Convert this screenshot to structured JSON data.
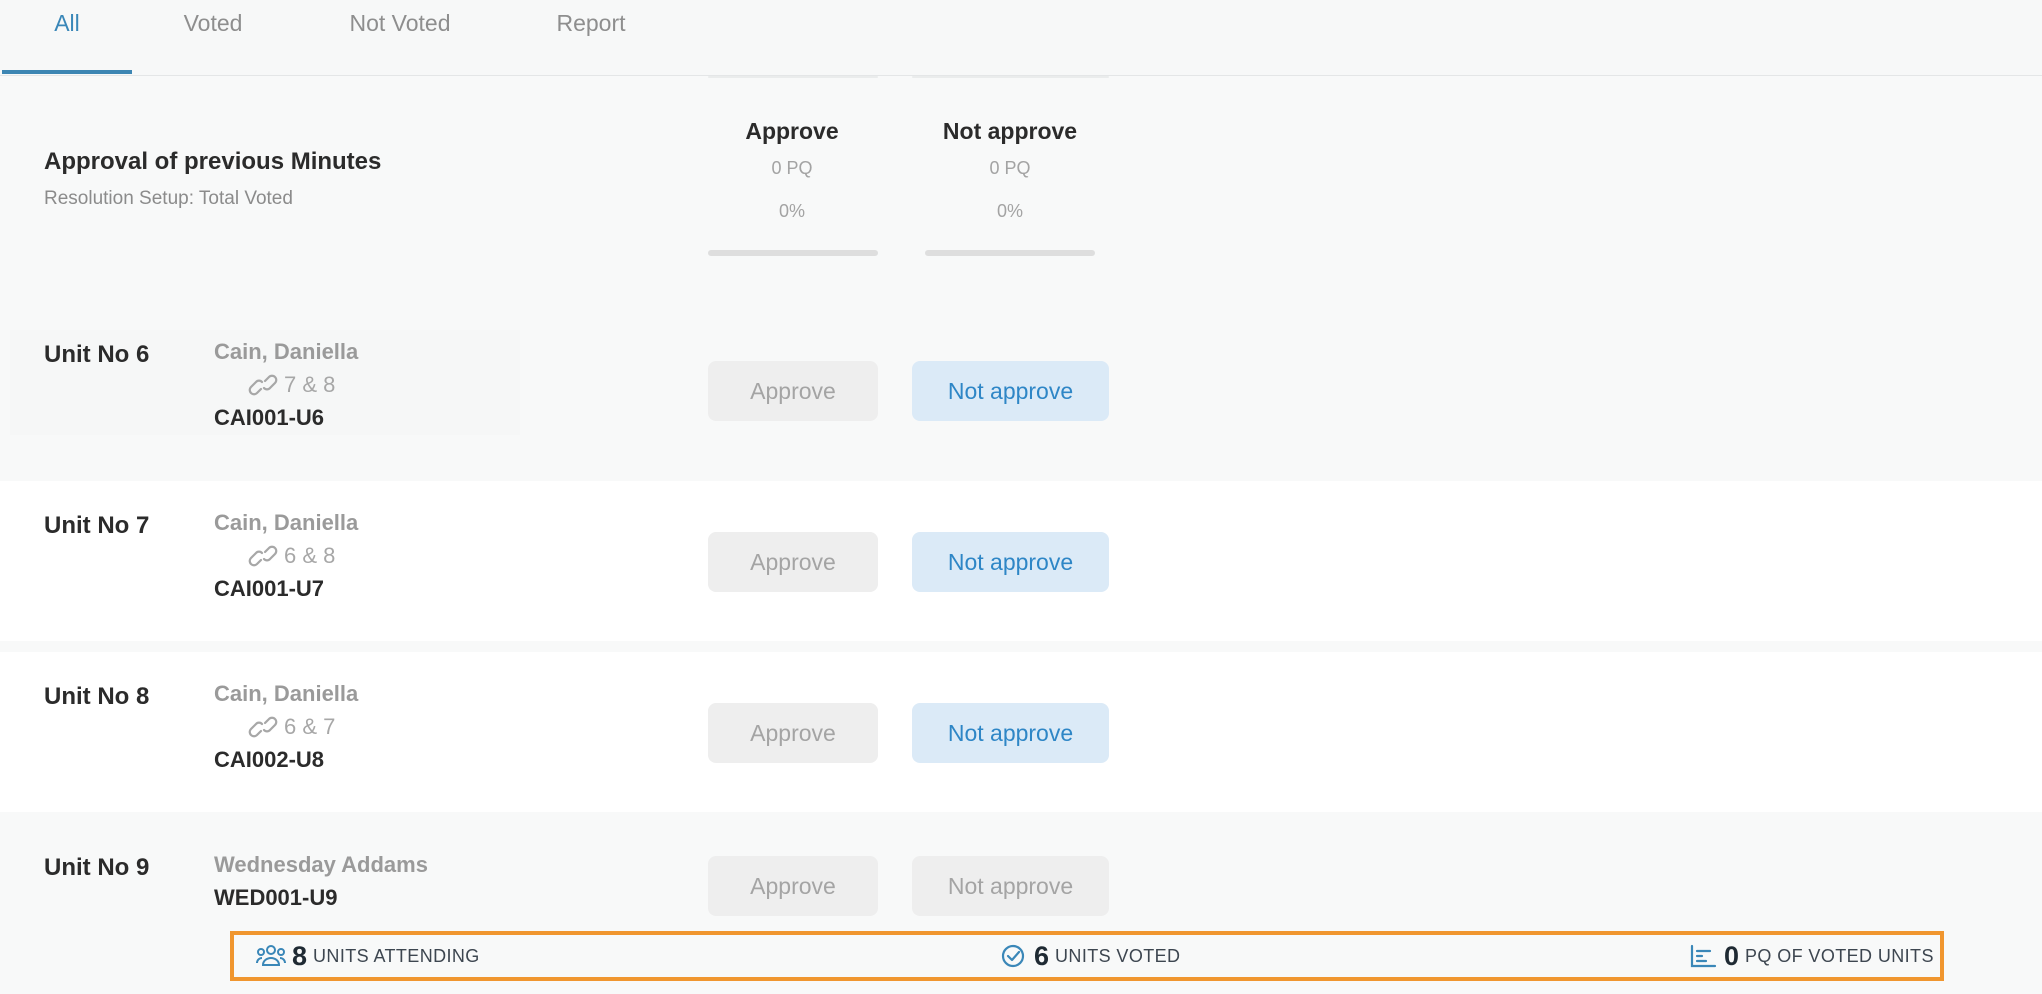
{
  "tabs": [
    {
      "label": "All",
      "active": true
    },
    {
      "label": "Voted",
      "active": false
    },
    {
      "label": "Not Voted",
      "active": false
    },
    {
      "label": "Report",
      "active": false
    }
  ],
  "resolution": {
    "title": "Approval of previous Minutes",
    "subtitle": "Resolution Setup: Total Voted",
    "options": [
      {
        "label": "Approve",
        "pq": "0 PQ",
        "percent": "0%",
        "progress": 0
      },
      {
        "label": "Not approve",
        "pq": "0 PQ",
        "percent": "0%",
        "progress": 0
      }
    ]
  },
  "units": [
    {
      "unit": "Unit No 6",
      "owner": "Cain, Daniella",
      "linked": "7 & 8",
      "code": "CAI001-U6",
      "approve_label": "Approve",
      "not_approve_label": "Not approve",
      "selected": "Not approve"
    },
    {
      "unit": "Unit No 7",
      "owner": "Cain, Daniella",
      "linked": "6 & 8",
      "code": "CAI001-U7",
      "approve_label": "Approve",
      "not_approve_label": "Not approve",
      "selected": "Not approve"
    },
    {
      "unit": "Unit No 8",
      "owner": "Cain, Daniella",
      "linked": "6 & 7",
      "code": "CAI002-U8",
      "approve_label": "Approve",
      "not_approve_label": "Not approve",
      "selected": "Not approve"
    },
    {
      "unit": "Unit No 9",
      "owner": "Wednesday Addams",
      "linked": "",
      "code": "WED001-U9",
      "approve_label": "Approve",
      "not_approve_label": "Not approve",
      "selected": ""
    }
  ],
  "stats": {
    "attending": {
      "value": "8",
      "label": "UNITS ATTENDING",
      "icon": "users-icon"
    },
    "voted": {
      "value": "6",
      "label": "UNITS VOTED",
      "icon": "check-circle-icon"
    },
    "pq": {
      "value": "0",
      "label": "PQ OF VOTED UNITS",
      "icon": "bar-chart-icon"
    }
  },
  "colors": {
    "accent": "#3d86b3",
    "selected_bg": "#dbeaf7",
    "selected_text": "#2e86c6",
    "highlight_border": "#f0962f"
  }
}
